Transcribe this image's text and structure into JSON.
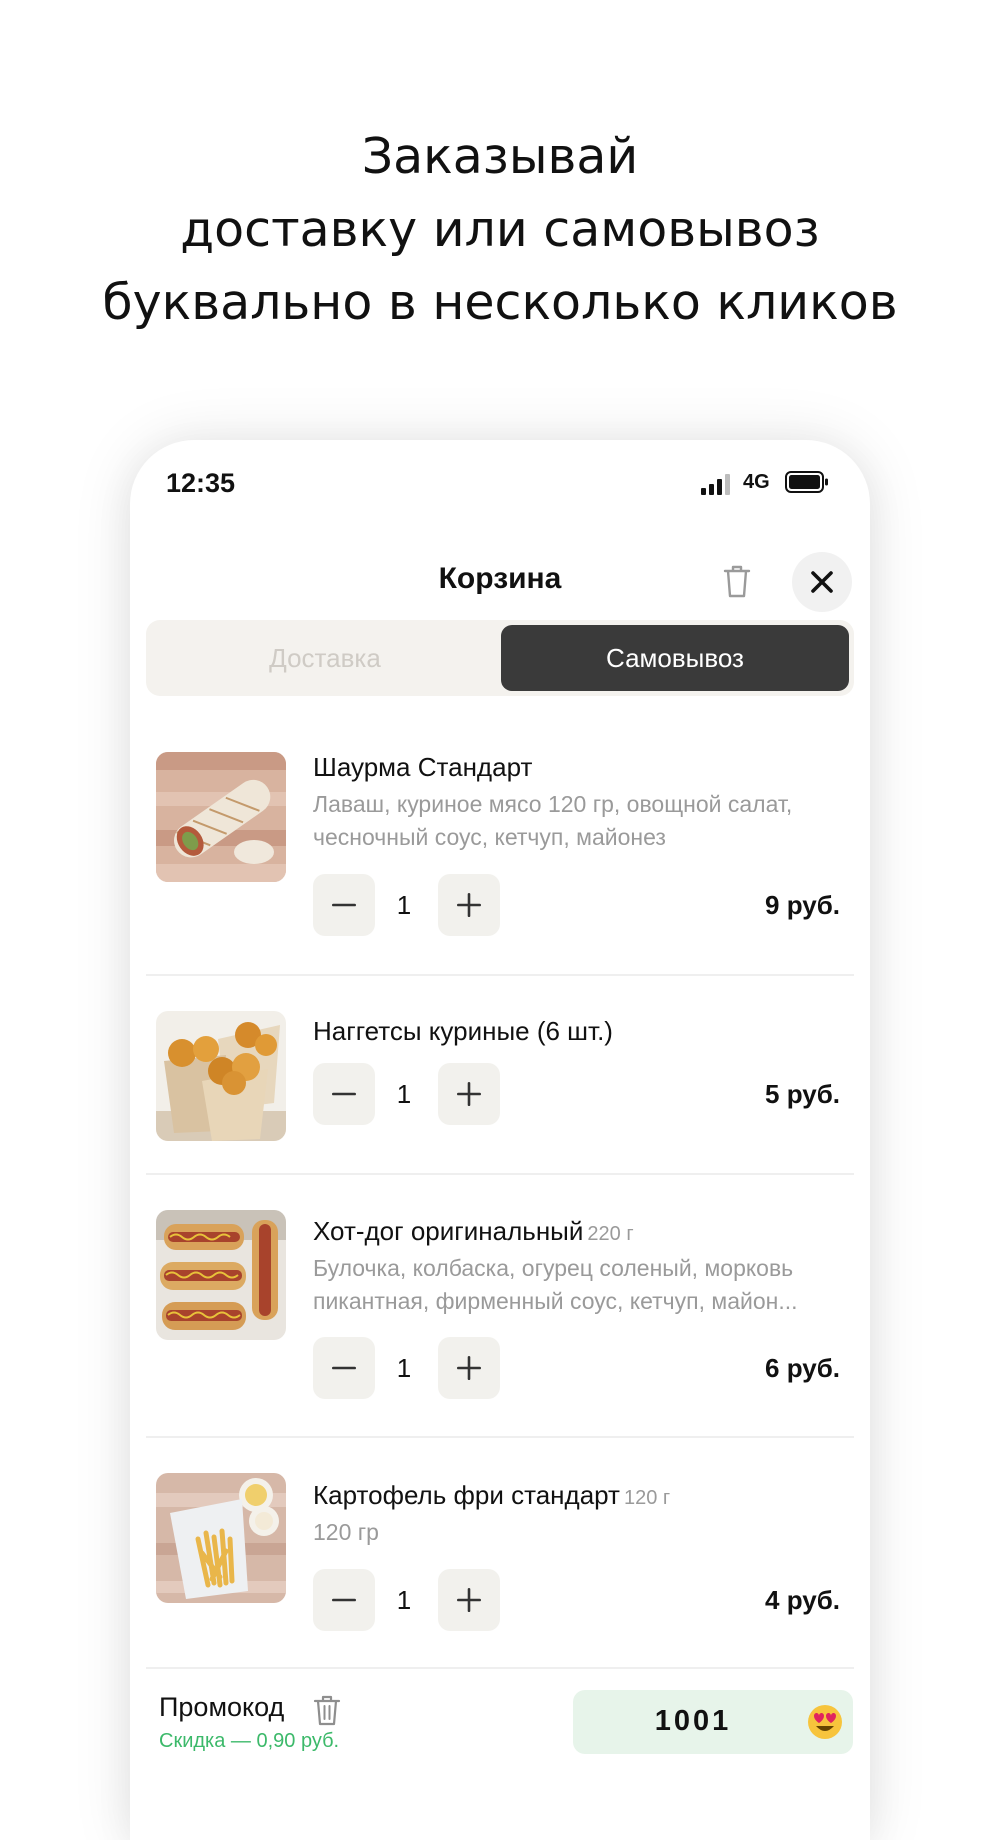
{
  "headline": {
    "line1": "Заказывай",
    "line2": "доставку или самовывоз",
    "line3": "буквально в несколько кликов"
  },
  "status_bar": {
    "time": "12:35",
    "network": "4G"
  },
  "cart": {
    "title": "Корзина",
    "tabs": {
      "delivery": "Доставка",
      "pickup": "Самовывоз",
      "selected": "pickup"
    },
    "items": [
      {
        "name": "Шаурма Стандарт",
        "weight": "",
        "desc_line1": "Лаваш, куриное мясо 120 гр, овощной салат,",
        "desc_line2": "чесночный соус, кетчуп, майонез",
        "qty": "1",
        "price": "9 руб."
      },
      {
        "name": "Наггетсы куриные (6 шт.)",
        "weight": "",
        "desc_line1": "",
        "desc_line2": "",
        "qty": "1",
        "price": "5 руб."
      },
      {
        "name": "Хот-дог оригинальный",
        "weight": "220 г",
        "desc_line1": "Булочка, колбаска, огурец соленый, морковь",
        "desc_line2": "пикантная, фирменный соус, кетчуп, майон...",
        "qty": "1",
        "price": "6 руб."
      },
      {
        "name": "Картофель фри стандарт",
        "weight": "120 г",
        "desc_line1": "120 гр",
        "desc_line2": "",
        "qty": "1",
        "price": "4 руб."
      }
    ],
    "promo": {
      "label": "Промокод",
      "discount": "Скидка — 0,90 руб.",
      "code": "1001"
    }
  },
  "colors": {
    "accent_dark": "#3a3a3a",
    "stepper_bg": "#f2f1ed",
    "promo_bg": "#e7f4ea",
    "discount_green": "#3cb96a"
  },
  "icons": [
    "signal-icon",
    "battery-icon",
    "trash-icon",
    "close-icon",
    "minus-icon",
    "plus-icon",
    "heart-eyes-emoji-icon"
  ]
}
